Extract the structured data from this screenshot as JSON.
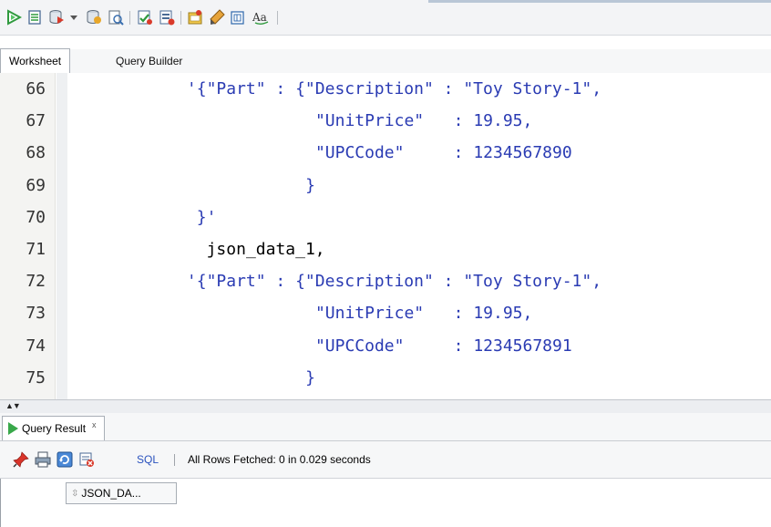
{
  "toolbar": {
    "icons": [
      "run-statement-icon",
      "run-script-icon",
      "commit-icon",
      "dropdown-arrow-icon",
      "rollback-icon",
      "explain-plan-icon",
      "autotrace-icon",
      "sql-tuning-icon",
      "sql-history-icon",
      "clear-icon",
      "find-icon",
      "format-case-icon"
    ]
  },
  "tabs": {
    "worksheet": "Worksheet",
    "query_builder": "Query Builder"
  },
  "editor": {
    "lines": [
      {
        "num": "66",
        "indent": 16,
        "text": "'{\"Part\" : {\"Description\" : \"Toy Story-1\",",
        "kind": "str"
      },
      {
        "num": "67",
        "indent": 29,
        "text": "\"UnitPrice\"   : 19.95,",
        "kind": "str"
      },
      {
        "num": "68",
        "indent": 29,
        "text": "\"UPCCode\"     : 1234567890",
        "kind": "str"
      },
      {
        "num": "69",
        "indent": 28,
        "text": "}",
        "kind": "str"
      },
      {
        "num": "70",
        "indent": 17,
        "text": "}'",
        "kind": "str"
      },
      {
        "num": "71",
        "indent": 18,
        "text": "json_data_1,",
        "kind": "idt"
      },
      {
        "num": "72",
        "indent": 16,
        "text": "'{\"Part\" : {\"Description\" : \"Toy Story-1\",",
        "kind": "str"
      },
      {
        "num": "73",
        "indent": 29,
        "text": "\"UnitPrice\"   : 19.95,",
        "kind": "str"
      },
      {
        "num": "74",
        "indent": 29,
        "text": "\"UPCCode\"     : 1234567891",
        "kind": "str"
      },
      {
        "num": "75",
        "indent": 28,
        "text": "}",
        "kind": "str"
      }
    ]
  },
  "result": {
    "tab_label": "Query Result",
    "tab_close": "x",
    "sql_link": "SQL",
    "status": "All Rows Fetched: 0 in 0.029 seconds",
    "column_header": "JSON_DA..."
  },
  "colors": {
    "string": "#2a3bb3",
    "run_green": "#38a84a",
    "link_blue": "#2a52be"
  }
}
